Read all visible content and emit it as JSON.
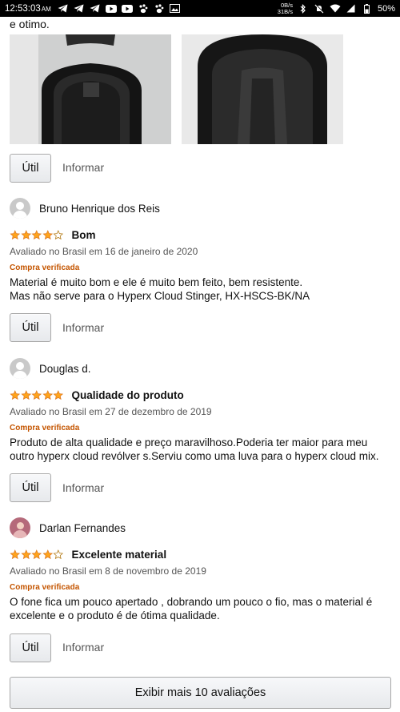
{
  "status_bar": {
    "time": "12:53:03",
    "time_suffix": "AM",
    "net_up": "0B/s",
    "net_down": "31B/s",
    "battery": "50%",
    "icons": [
      "telegram-icon",
      "telegram-icon",
      "telegram-icon",
      "youtube-icon",
      "youtube-icon",
      "paw-icon",
      "paw-icon",
      "gallery-icon",
      "bluetooth-icon",
      "mute-icon",
      "wifi-icon",
      "signal-icon",
      "battery-icon"
    ]
  },
  "top_text": "e otimo.",
  "photos": [
    "case-open-photo",
    "case-inner-photo"
  ],
  "util_label": "Útil",
  "report_label": "Informar",
  "reviews": [
    {
      "author": "Bruno Henrique dos Reis",
      "rating": 4,
      "title": "Bom",
      "date": "Avaliado no Brasil em 16 de janeiro de 2020",
      "verified": "Compra verificada",
      "body": "Material é muito bom e ele é muito bem feito, bem resistente.\nMas não serve para o Hyperx Cloud Stinger, HX-HSCS-BK/NA"
    },
    {
      "author": "Douglas d.",
      "rating": 5,
      "title": "Qualidade do produto",
      "date": "Avaliado no Brasil em 27 de dezembro de 2019",
      "verified": "Compra verificada",
      "body": "Produto de alta qualidade e preço maravilhoso.Poderia ter maior para meu outro hyperx cloud revólver s.Serviu como uma luva para o hyperx cloud mix."
    },
    {
      "author": "Darlan Fernandes",
      "rating": 4,
      "title": "Excelente material",
      "date": "Avaliado no Brasil em 8 de novembro de 2019",
      "verified": "Compra verificada",
      "body": "O fone fica um pouco apertado , dobrando um pouco o fio, mas o material é excelente e o produto é de ótima qualidade."
    }
  ],
  "more_button": "Exibir mais 10  avaliações",
  "colors": {
    "star": "#ffa41c",
    "verified": "#c45500"
  }
}
